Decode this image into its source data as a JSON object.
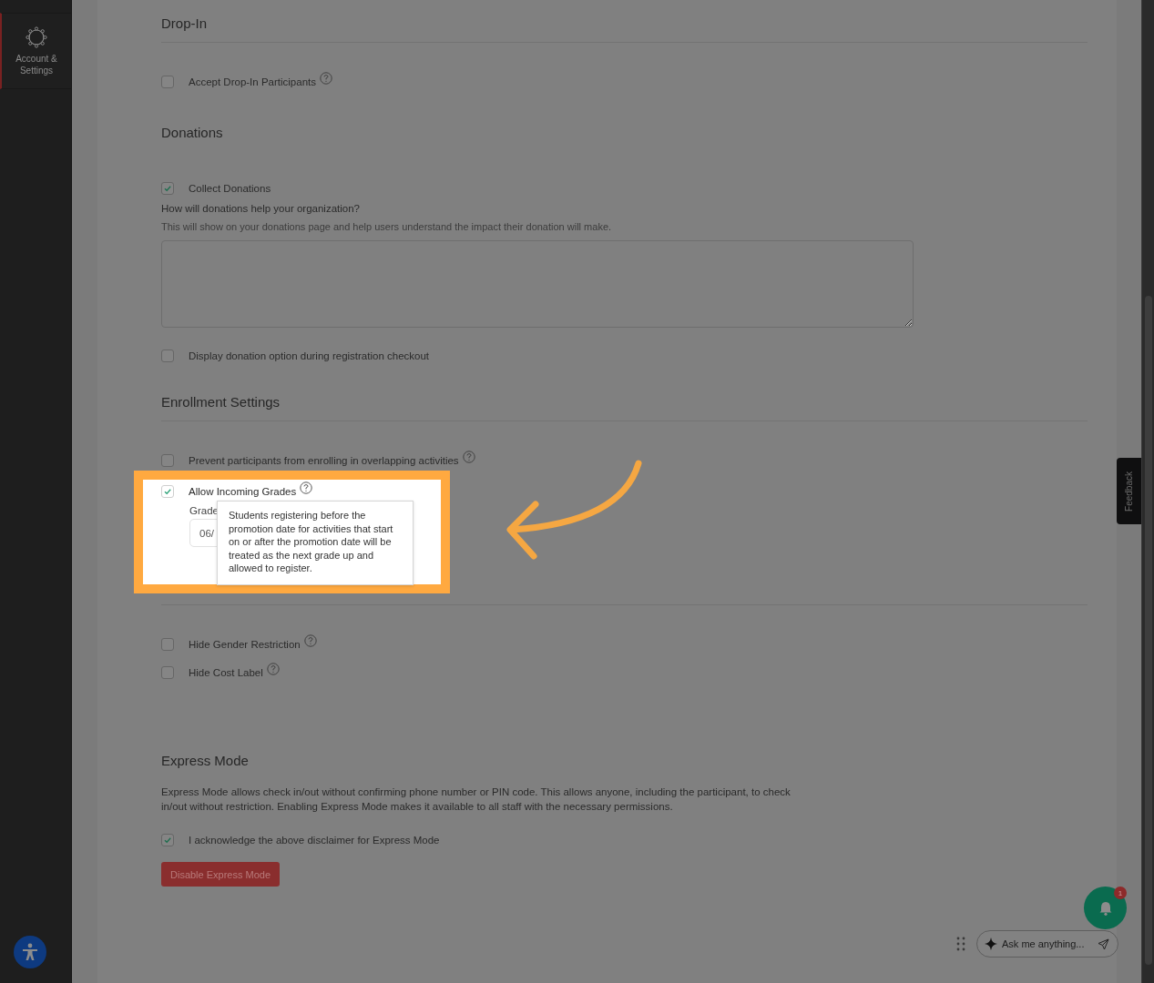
{
  "sidebar": {
    "items": [
      {
        "label": "Account & Settings",
        "selected": true
      }
    ]
  },
  "sections": [
    {
      "title": "Drop-In",
      "divider": true,
      "items": [
        {
          "kind": "checkbox",
          "label": "Accept Drop-In Participants",
          "checked": false,
          "help": true
        }
      ]
    },
    {
      "title": "Donations",
      "divider": false,
      "items": [
        {
          "kind": "checkbox",
          "label": "Collect Donations",
          "checked": true,
          "help": false
        },
        {
          "kind": "question",
          "text": "How will donations help your organization?"
        },
        {
          "kind": "hint",
          "text": "This will show on your donations page and help users understand the impact their donation will make."
        },
        {
          "kind": "textarea"
        },
        {
          "kind": "checkbox",
          "label": "Display donation option during registration checkout",
          "checked": false,
          "help": false
        }
      ]
    },
    {
      "title": "Enrollment Settings",
      "divider": true,
      "items": [
        {
          "kind": "checkbox",
          "label": "Prevent participants from enrolling in overlapping activities",
          "checked": false,
          "help": true
        },
        {
          "kind": "spotlight",
          "label": "Allow Incoming Grades",
          "checked": true,
          "help": true,
          "field_label": "Grade",
          "field_value": "06/",
          "tooltip": "Students registering before the promotion date for activities that start on or after the promotion date will be treated as the next grade up and allowed to register."
        }
      ]
    },
    {
      "divider": true,
      "items": [
        {
          "kind": "checkbox",
          "label": "Hide Gender Restriction",
          "checked": false,
          "help": true
        },
        {
          "kind": "checkbox",
          "label": "Hide Cost Label",
          "checked": false,
          "help": true
        }
      ]
    },
    {
      "title": "Express Mode",
      "divider": false,
      "items": [
        {
          "kind": "paragraph",
          "text": "Express Mode allows check in/out without confirming phone number or PIN code. This allows anyone, including the participant, to check in/out without restriction. Enabling Express Mode makes it available to all staff with the necessary permissions."
        },
        {
          "kind": "checkbox",
          "label": "I acknowledge the above disclaimer for Express Mode",
          "checked": true,
          "help": false
        },
        {
          "kind": "button",
          "label": "Disable Express Mode"
        }
      ]
    }
  ],
  "feedback": {
    "label": "Feedback"
  },
  "notifications": {
    "badge": "1"
  },
  "assistant": {
    "placeholder": "Ask me anything..."
  }
}
